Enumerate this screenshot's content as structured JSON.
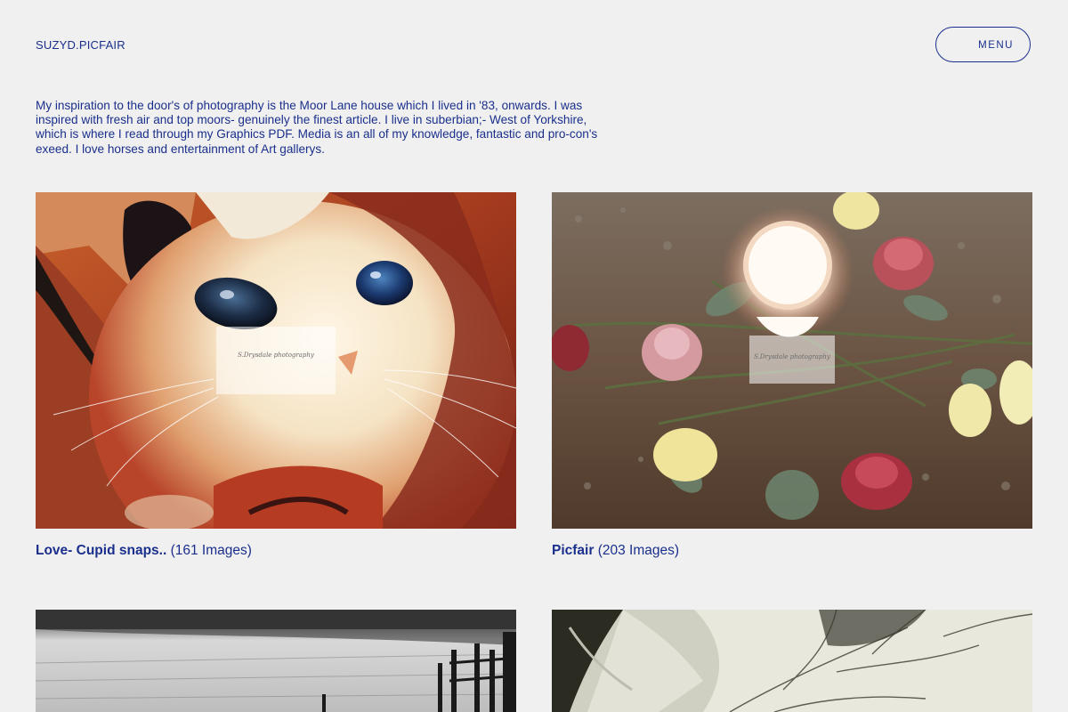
{
  "header": {
    "brand": "SUZYD.PICFAIR",
    "menu_label": "MENU"
  },
  "intro": {
    "text": "My inspiration to the door's of photography is the Moor Lane house which I lived in '83, onwards. I was inspired with fresh air and top moors- genuinely the finest article. I live in suberbian;- West of Yorkshire, which is where I read through my Graphics PDF. Media is an all of my knowledge, fantastic and pro-con's exeed. I love horses and entertainment of Art gallerys."
  },
  "albums": [
    {
      "title": "Love- Cupid snaps..",
      "count": "(161 Images)",
      "image": "cat-closeup-photo"
    },
    {
      "title": "Picfair",
      "count": "(203 Images)",
      "image": "candle-roses-photo"
    },
    {
      "title": "",
      "count": "",
      "image": "moor-fence-bw-photo"
    },
    {
      "title": "",
      "count": "",
      "image": "leaf-texture-photo"
    }
  ],
  "colors": {
    "background": "#f0f0f0",
    "accent": "#1a2f8c"
  }
}
